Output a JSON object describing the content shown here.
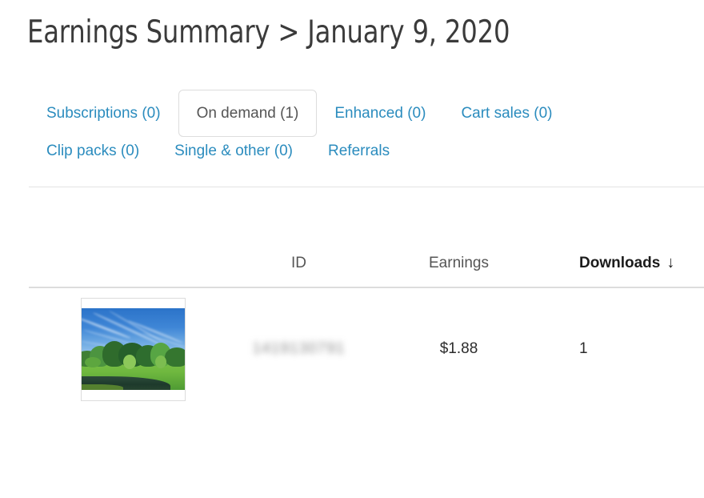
{
  "page": {
    "title": "Earnings Summary > January 9, 2020"
  },
  "tabs": {
    "row1": [
      {
        "label": "Subscriptions (0)",
        "active": false
      },
      {
        "label": "On demand (1)",
        "active": true
      },
      {
        "label": "Enhanced (0)",
        "active": false
      },
      {
        "label": "Cart sales (0)",
        "active": false
      }
    ],
    "row2": [
      {
        "label": "Clip packs (0)",
        "active": false
      },
      {
        "label": "Single & other (0)",
        "active": false
      },
      {
        "label": "Referrals",
        "active": false
      }
    ]
  },
  "table": {
    "columns": {
      "thumbnail": "",
      "id": "ID",
      "earnings": "Earnings",
      "downloads": "Downloads"
    },
    "sort": {
      "column": "Downloads",
      "direction": "descending",
      "icon": "arrow-down-icon",
      "glyph": "↓"
    },
    "rows": [
      {
        "thumbnail_alt": "landscape photo of green park trees and pond under blue sky",
        "id": "1419130791",
        "id_redacted": true,
        "earnings": "$1.88",
        "downloads": "1"
      }
    ]
  },
  "colors": {
    "link_blue": "#2b8cbe",
    "active_tab_text": "#555555",
    "title_text": "#3b3b3b",
    "header_text": "#555555",
    "sorted_header_text": "#1c1c1c",
    "divider": "#e2e2e2",
    "header_rule": "#dcdcdc",
    "background": "#ffffff"
  }
}
